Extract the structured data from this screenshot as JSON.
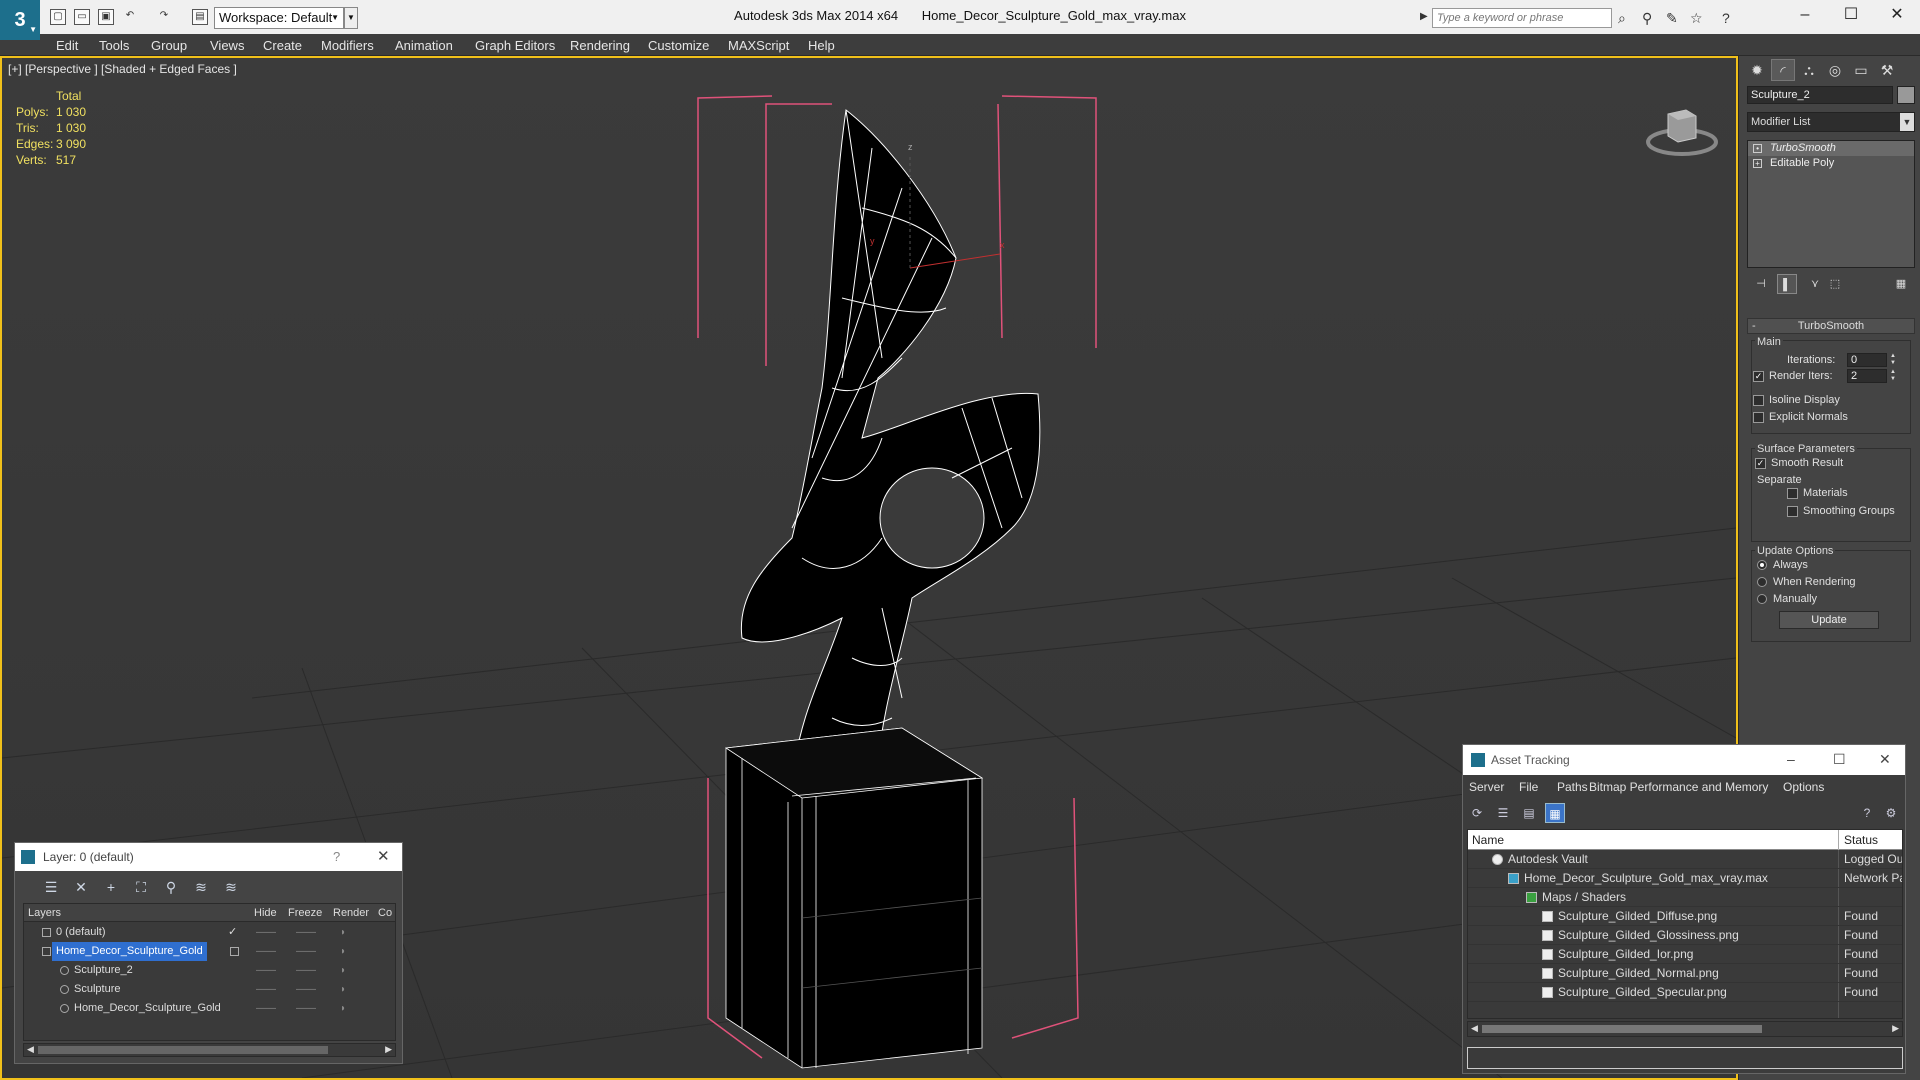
{
  "titlebar": {
    "app_title": "Autodesk 3ds Max  2014 x64",
    "file_name": "Home_Decor_Sculpture_Gold_max_vray.max",
    "workspace": "Workspace: Default",
    "search_placeholder": "Type a keyword or phrase"
  },
  "menu": [
    "Edit",
    "Tools",
    "Group",
    "Views",
    "Create",
    "Modifiers",
    "Animation",
    "Graph Editors",
    "Rendering",
    "Customize",
    "MAXScript",
    "Help"
  ],
  "viewport": {
    "label": "[+] [Perspective ] [Shaded + Edged Faces ]",
    "stats": {
      "header": "Total",
      "rows": [
        {
          "label": "Polys:",
          "value": "1 030"
        },
        {
          "label": "Tris:",
          "value": "1 030"
        },
        {
          "label": "Edges:",
          "value": "3 090"
        },
        {
          "label": "Verts:",
          "value": "517"
        }
      ]
    }
  },
  "command_panel": {
    "object_name": "Sculpture_2",
    "modifier_list": "Modifier List",
    "stack": [
      "TurboSmooth",
      "Editable Poly"
    ],
    "rollout_title": "TurboSmooth",
    "main_group": "Main",
    "iterations_label": "Iterations:",
    "iterations_value": "0",
    "render_iters_label": "Render Iters:",
    "render_iters_value": "2",
    "isoline_label": "Isoline Display",
    "explicit_normals_label": "Explicit Normals",
    "surface_params": "Surface Parameters",
    "smooth_result": "Smooth Result",
    "separate": "Separate",
    "materials": "Materials",
    "smoothing_groups": "Smoothing Groups",
    "update_options": "Update Options",
    "always": "Always",
    "when_rendering": "When Rendering",
    "manually": "Manually",
    "update_button": "Update"
  },
  "layer_window": {
    "title": "Layer: 0 (default)",
    "help": "?",
    "columns": [
      "Layers",
      "Hide",
      "Freeze",
      "Render",
      "Co"
    ],
    "rows": [
      {
        "name": "0 (default)",
        "indent": 0
      },
      {
        "name": "Home_Decor_Sculpture_Gold",
        "indent": 0
      },
      {
        "name": "Sculpture_2",
        "indent": 1
      },
      {
        "name": "Sculpture",
        "indent": 1
      },
      {
        "name": "Home_Decor_Sculpture_Gold",
        "indent": 1
      }
    ]
  },
  "asset_tracking": {
    "title": "Asset Tracking",
    "menu": [
      "Server",
      "File",
      "Paths",
      "Bitmap Performance and Memory",
      "Options"
    ],
    "columns": [
      "Name",
      "Status"
    ],
    "rows": [
      {
        "name": "Autodesk Vault",
        "status": "Logged Out",
        "indent": 1
      },
      {
        "name": "Home_Decor_Sculpture_Gold_max_vray.max",
        "status": "Network Pa",
        "indent": 2
      },
      {
        "name": "Maps / Shaders",
        "status": "",
        "indent": 3
      },
      {
        "name": "Sculpture_Gilded_Diffuse.png",
        "status": "Found",
        "indent": 4
      },
      {
        "name": "Sculpture_Gilded_Glossiness.png",
        "status": "Found",
        "indent": 4
      },
      {
        "name": "Sculpture_Gilded_Ior.png",
        "status": "Found",
        "indent": 4
      },
      {
        "name": "Sculpture_Gilded_Normal.png",
        "status": "Found",
        "indent": 4
      },
      {
        "name": "Sculpture_Gilded_Specular.png",
        "status": "Found",
        "indent": 4
      }
    ]
  },
  "colors": {
    "viewport_border": "#f0c01a",
    "selection_bounds": "#e0527a",
    "stats_text": "#f0e060",
    "selected_row": "#2f6fd0"
  }
}
